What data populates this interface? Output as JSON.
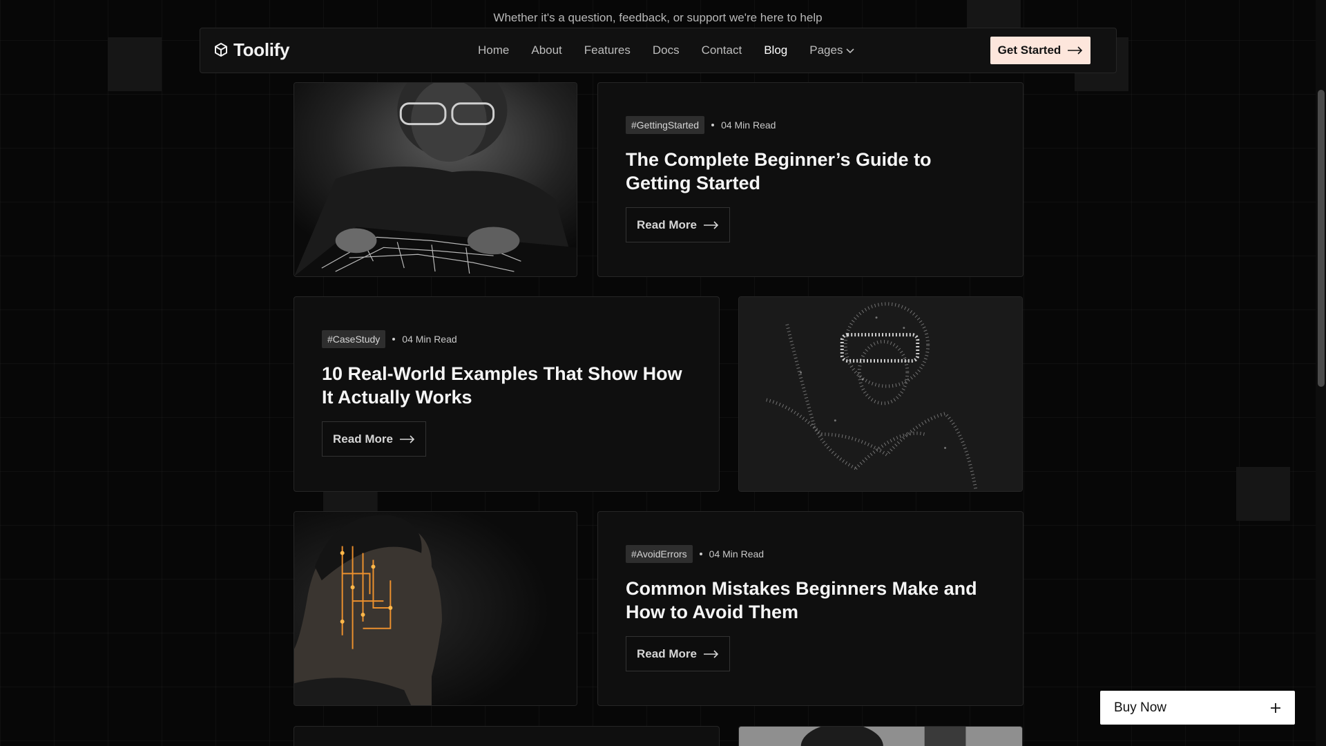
{
  "top_message": "Whether it's a question, feedback, or support we're here to help",
  "brand": {
    "name": "Toolify",
    "icon": "cube-logo-icon"
  },
  "nav": {
    "items": [
      {
        "label": "Home"
      },
      {
        "label": "About"
      },
      {
        "label": "Features"
      },
      {
        "label": "Docs"
      },
      {
        "label": "Contact"
      },
      {
        "label": "Blog",
        "active": true
      },
      {
        "label": "Pages",
        "icon": "chevron-down-icon"
      }
    ],
    "cta_label": "Get Started",
    "cta_icon": "arrow-right-icon"
  },
  "posts": [
    {
      "tag": "#GettingStarted",
      "read_time": "04 Min Read",
      "title": "The Complete Beginner’s Guide to Getting Started",
      "button": "Read More",
      "image": "man-working-on-circuit-board"
    },
    {
      "tag": "#CaseStudy",
      "read_time": "04 Min Read",
      "title": "10 Real-World Examples That Show How It Actually Works",
      "button": "Read More",
      "image": "particle-person-vr-headset"
    },
    {
      "tag": "#AvoidErrors",
      "read_time": "04 Min Read",
      "title": "Common Mistakes Beginners Make and How to Avoid Them",
      "button": "Read More",
      "image": "man-profile-circuit-face"
    }
  ],
  "buy_now": {
    "label": "Buy Now",
    "icon": "plus-icon"
  },
  "colors": {
    "background": "#070707",
    "card": "#0f0f0f",
    "cta": "#fde6dc",
    "accent_orange": "#ff9a2e"
  }
}
